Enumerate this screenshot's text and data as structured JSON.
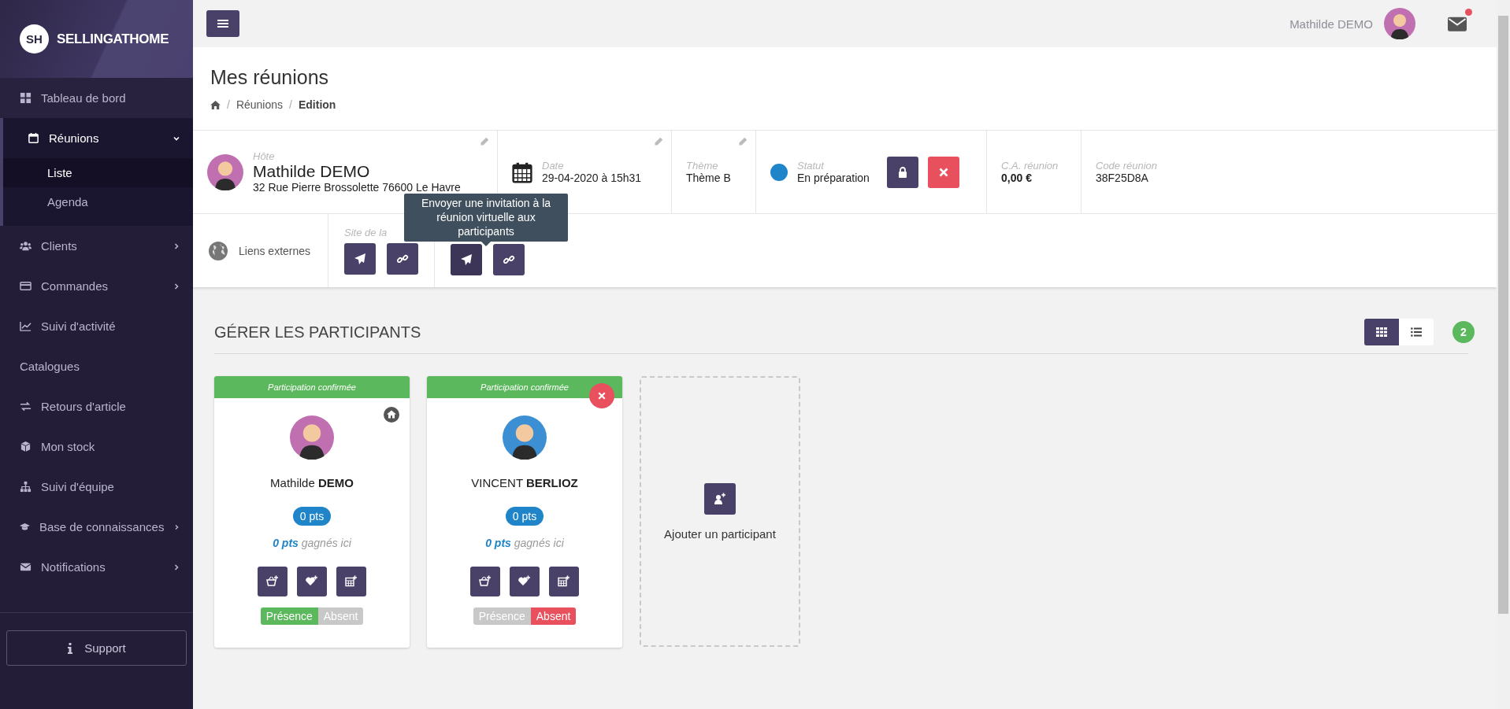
{
  "brand": {
    "mark": "SH",
    "name": "SELLINGATHOME"
  },
  "sidebar": {
    "items": [
      {
        "label": "Tableau de bord",
        "kind": "plain"
      },
      {
        "label": "Réunions",
        "kind": "group",
        "expanded": true,
        "children": [
          {
            "label": "Liste",
            "selected": true
          },
          {
            "label": "Agenda",
            "selected": false
          }
        ]
      },
      {
        "label": "Clients",
        "kind": "group",
        "expanded": false
      },
      {
        "label": "Commandes",
        "kind": "group",
        "expanded": false
      },
      {
        "label": "Suivi d'activité",
        "kind": "plain"
      },
      {
        "label": "Catalogues",
        "kind": "bare"
      },
      {
        "label": "Retours d'article",
        "kind": "plain"
      },
      {
        "label": "Mon stock",
        "kind": "plain"
      },
      {
        "label": "Suivi d'équipe",
        "kind": "plain"
      },
      {
        "label": "Base de connaissances",
        "kind": "group",
        "expanded": false
      },
      {
        "label": "Notifications",
        "kind": "group",
        "expanded": false
      }
    ],
    "support": "Support"
  },
  "topbar": {
    "user": "Mathilde DEMO",
    "unread": true
  },
  "page": {
    "title": "Mes réunions",
    "separator": "/",
    "breadcrumb": [
      "Réunions",
      "Edition"
    ]
  },
  "meeting": {
    "host": {
      "label": "Hôte",
      "name": "Mathilde DEMO",
      "address": "32 Rue Pierre Brossolette 76600 Le Havre"
    },
    "date": {
      "label": "Date",
      "value": "29-04-2020 à 15h31"
    },
    "theme": {
      "label": "Thème",
      "value": "Thème B"
    },
    "status": {
      "label": "Statut",
      "value": "En préparation",
      "color": "#1f84c8"
    },
    "revenue": {
      "label": "C.A. réunion",
      "value": "0,00 €"
    },
    "code": {
      "label": "Code réunion",
      "value": "38F25D8A"
    }
  },
  "links": {
    "title": "Liens externes",
    "site_label": "Site de la",
    "tooltip": "Envoyer une invitation à la réunion virtuelle aux participants"
  },
  "participants": {
    "title": "GÉRER LES PARTICIPANTS",
    "count": "2",
    "views": [
      {
        "kind": "grid",
        "selected": true
      },
      {
        "kind": "list",
        "selected": false
      }
    ],
    "cards": [
      {
        "banner": "Participation confirmée",
        "name": "Mathilde **DEMO**",
        "color": "#c06fb0",
        "host": true,
        "removable": false,
        "points": "0 pts",
        "earned": "**0 pts** gagnés ici",
        "attendance": [
          {
            "label": "Présence",
            "selected": true
          },
          {
            "label": "Absent",
            "selected": false
          }
        ]
      },
      {
        "banner": "Participation confirmée",
        "name": "VINCENT **BERLIOZ**",
        "color": "#3c8fd2",
        "host": false,
        "removable": true,
        "points": "0 pts",
        "earned": "**0 pts** gagnés ici",
        "attendance": [
          {
            "label": "Présence",
            "selected": false
          },
          {
            "label": "Absent",
            "selected": true
          }
        ]
      }
    ],
    "add": "Ajouter un participant"
  }
}
